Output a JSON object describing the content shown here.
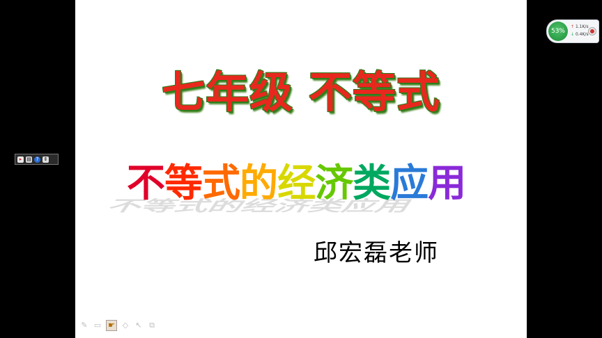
{
  "slide": {
    "title_part1": "七年级",
    "title_part2": "不等式",
    "subtitle_chars": [
      "不",
      "等",
      "式",
      "的",
      "经",
      "济",
      "类",
      "应",
      "用"
    ],
    "subtitle_colors": [
      "#e0002a",
      "#ff2a00",
      "#ff6a00",
      "#ffaa00",
      "#d8d800",
      "#66c800",
      "#00a860",
      "#2a7ad8",
      "#8a2ad8"
    ],
    "author": "邱宏磊老师"
  },
  "system_monitor": {
    "cpu_percent": "53%",
    "upload_speed": "1.1K/s",
    "download_speed": "0.4K/s",
    "upload_arrow": "↑",
    "download_arrow": "↓"
  },
  "side_toolbar": {
    "icons": [
      "pointer-icon",
      "document-icon",
      "help-icon",
      "scroll-arrows-icon"
    ]
  },
  "bottom_toolbar": {
    "icons": [
      "pen-icon",
      "screen-icon",
      "pointer-hand-icon",
      "eraser-icon",
      "arrow-icon",
      "screen-tool-icon"
    ]
  }
}
